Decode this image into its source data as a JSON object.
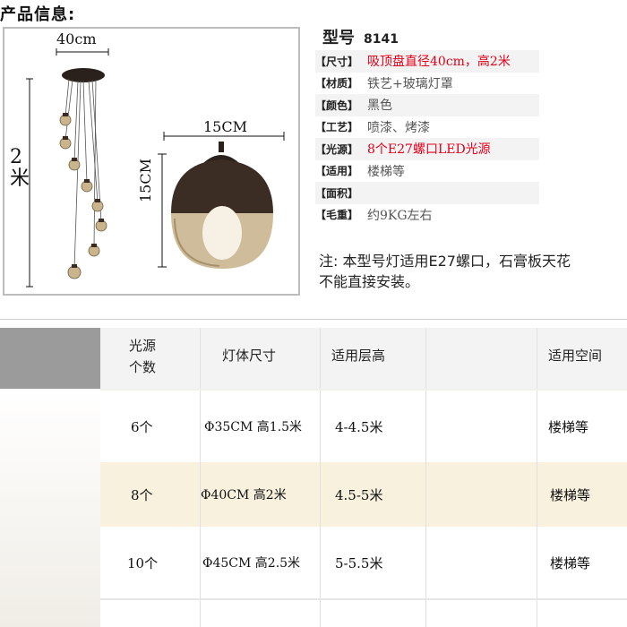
{
  "section_title": "产品信息:",
  "product_image": {
    "dim_top": "40cm",
    "dim_height": "2米",
    "dim_shade_width": "15CM",
    "dim_shade_height": "15CM"
  },
  "model": {
    "label": "型号",
    "number": "8141"
  },
  "specs": [
    {
      "label": "【尺寸】",
      "value": "吸顶盘直径40cm，高2米",
      "highlight": true
    },
    {
      "label": "【材质】",
      "value": "铁艺+玻璃灯罩",
      "highlight": false
    },
    {
      "label": "【颜色】",
      "value": "黑色",
      "highlight": false
    },
    {
      "label": "【工艺】",
      "value": "喷漆、烤漆",
      "highlight": false
    },
    {
      "label": "【光源】",
      "value": "8个E27螺口LED光源",
      "highlight": true
    },
    {
      "label": "【适用】",
      "value": "楼梯等",
      "highlight": false
    },
    {
      "label": "【面积】",
      "value": "",
      "highlight": false
    },
    {
      "label": "【毛重】",
      "value": " 约9KG左右",
      "highlight": false
    }
  ],
  "note": {
    "line1": "注: 本型号灯适用E27螺口，石膏板天花",
    "line2": "不能直接安装。"
  },
  "size_table": {
    "headers": [
      "光源\n个数",
      "灯体尺寸",
      "适用层高",
      "",
      "适用空间"
    ],
    "rows": [
      [
        "6个",
        "Φ35CM 高1.5米",
        "4-4.5米",
        "",
        "楼梯等"
      ],
      [
        "8个",
        "Φ40CM 高2米",
        "4.5-5米",
        "",
        "楼梯等"
      ],
      [
        "10个",
        "Φ45CM 高2.5米",
        "5-5.5米",
        "",
        "楼梯等"
      ]
    ]
  }
}
